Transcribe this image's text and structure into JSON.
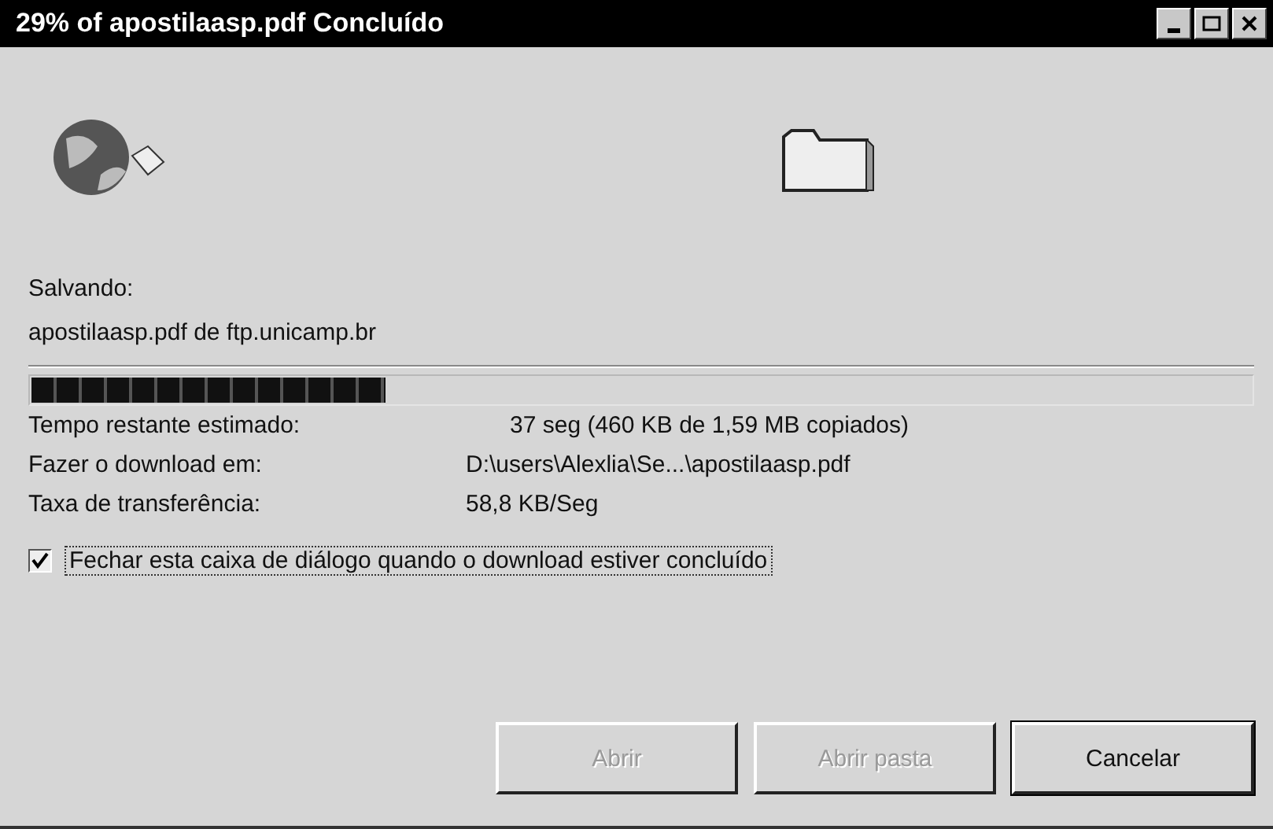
{
  "window": {
    "title": "29% of apostilaasp.pdf Concluído"
  },
  "status": {
    "label": "Salvando:",
    "source": "apostilaasp.pdf de ftp.unicamp.br"
  },
  "progress": {
    "level": 0.29
  },
  "details": [
    {
      "label": "Tempo restante estimado:",
      "value": "37 seg (460 KB de 1,59 MB copiados)"
    },
    {
      "label": "Fazer o download em:",
      "value": "D:\\users\\Alexlia\\Se...\\apostilaasp.pdf"
    },
    {
      "label": "Taxa de transferência:",
      "value": "58,8 KB/Seg"
    }
  ],
  "close_when_done": {
    "label": "Fechar esta caixa de diálogo quando o download estiver concluído",
    "checked": true
  },
  "buttons": [
    {
      "label": "Abrir",
      "disabled": true
    },
    {
      "label": "Abrir pasta",
      "disabled": true
    },
    {
      "label": "Cancelar",
      "disabled": false
    }
  ]
}
